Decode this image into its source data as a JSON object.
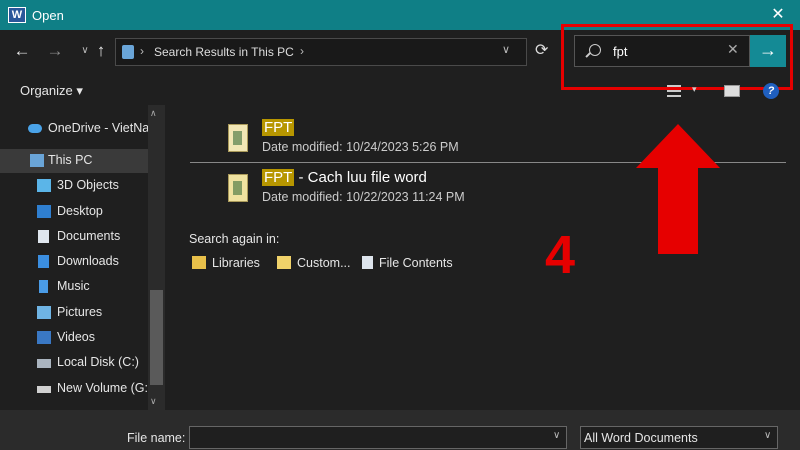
{
  "window": {
    "title": "Open",
    "app_icon": "W",
    "close_glyph": "✕"
  },
  "nav": {
    "back_glyph": "←",
    "forward_glyph": "→",
    "up_glyph": "↑",
    "recent_glyph": "∨",
    "address_sep": "›",
    "address_text": "Search Results in This PC",
    "address_dropdown": "∨",
    "refresh_glyph": "⟳"
  },
  "search": {
    "value": "fpt",
    "clear_glyph": "✕",
    "go_glyph": "→"
  },
  "toolbar": {
    "organize_label": "Organize ▾",
    "view_dropdown": "▾",
    "help_glyph": "?"
  },
  "sidebar": {
    "items": [
      {
        "label": "OneDrive - VietNa",
        "icon": "cloud-icon"
      },
      {
        "label": "This PC",
        "icon": "computer-icon"
      },
      {
        "label": "3D Objects",
        "icon": "3d-objects-icon"
      },
      {
        "label": "Desktop",
        "icon": "desktop-icon"
      },
      {
        "label": "Documents",
        "icon": "documents-icon"
      },
      {
        "label": "Downloads",
        "icon": "downloads-icon"
      },
      {
        "label": "Music",
        "icon": "music-icon"
      },
      {
        "label": "Pictures",
        "icon": "pictures-icon"
      },
      {
        "label": "Videos",
        "icon": "videos-icon"
      },
      {
        "label": "Local Disk (C:)",
        "icon": "drive-icon"
      },
      {
        "label": "New Volume (G:)",
        "icon": "drive-icon"
      }
    ],
    "scroll_up": "∧",
    "scroll_down": "∨"
  },
  "results": [
    {
      "highlight": "FPT",
      "rest": "",
      "meta": "Date modified: 10/24/2023 5:26 PM"
    },
    {
      "highlight": "FPT",
      "rest": " - Cach luu file word",
      "meta": "Date modified: 10/22/2023 11:24 PM"
    }
  ],
  "search_again": {
    "label": "Search again in:",
    "items": [
      {
        "label": "Libraries",
        "icon": "libraries-icon"
      },
      {
        "label": "Custom...",
        "icon": "custom-folder-icon"
      },
      {
        "label": "File Contents",
        "icon": "file-contents-icon"
      }
    ]
  },
  "annotation": {
    "step_number": "4",
    "color": "#e60000"
  },
  "footer": {
    "file_name_label": "File name:",
    "file_name_value": "",
    "file_type_value": "All Word Documents",
    "dropdown_glyph": "∨"
  },
  "colors": {
    "titlebar": "#0f7f86",
    "accent": "#148a95",
    "highlight": "#b79600",
    "background": "#1f1f1f"
  }
}
